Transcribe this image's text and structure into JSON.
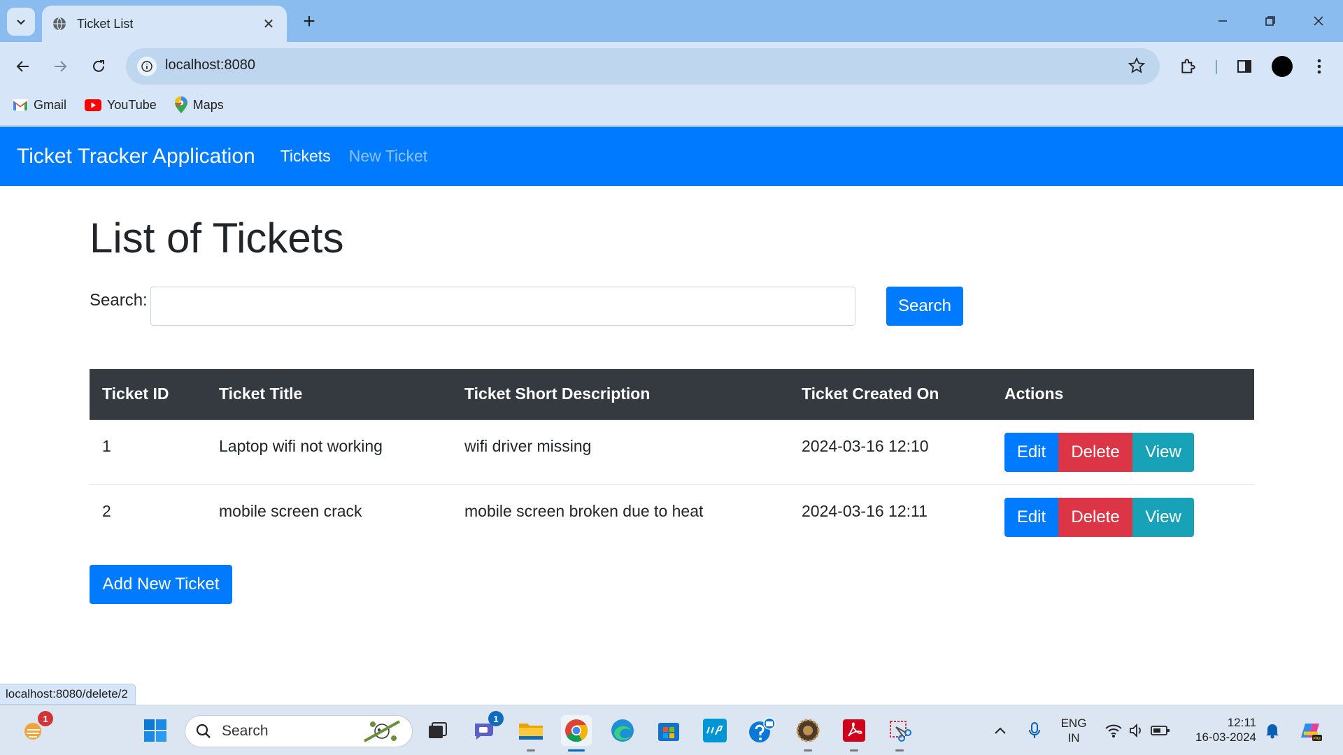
{
  "browser": {
    "tab_title": "Ticket List",
    "url": "localhost:8080",
    "bookmarks": [
      {
        "label": "Gmail",
        "icon": "gmail-icon"
      },
      {
        "label": "YouTube",
        "icon": "youtube-icon"
      },
      {
        "label": "Maps",
        "icon": "maps-icon"
      }
    ],
    "status_link": "localhost:8080/delete/2"
  },
  "navbar": {
    "brand": "Ticket Tracker Application",
    "links": [
      "Tickets",
      "New Ticket"
    ],
    "color": "#007bff"
  },
  "page": {
    "title": "List of Tickets",
    "search_label": "Search:",
    "search_value": "",
    "search_button": "Search",
    "add_button": "Add New Ticket"
  },
  "table": {
    "headers": [
      "Ticket ID",
      "Ticket Title",
      "Ticket Short Description",
      "Ticket Created On",
      "Actions"
    ],
    "rows": [
      {
        "id": "1",
        "title": "Laptop wifi not working",
        "description": "wifi driver missing",
        "created": "2024-03-16 12:10"
      },
      {
        "id": "2",
        "title": "mobile screen crack",
        "description": "mobile screen broken due to heat",
        "created": "2024-03-16 12:11"
      }
    ],
    "actions": {
      "edit": "Edit",
      "delete": "Delete",
      "view": "View"
    },
    "colors": {
      "edit": "#007bff",
      "delete": "#dc3545",
      "view": "#17a2b8",
      "header": "#343a40"
    }
  },
  "taskbar": {
    "search_placeholder": "Search",
    "weather_badge": "1",
    "teams_badge": "1",
    "language": [
      "ENG",
      "IN"
    ],
    "time": "12:11",
    "date": "16-03-2024"
  }
}
